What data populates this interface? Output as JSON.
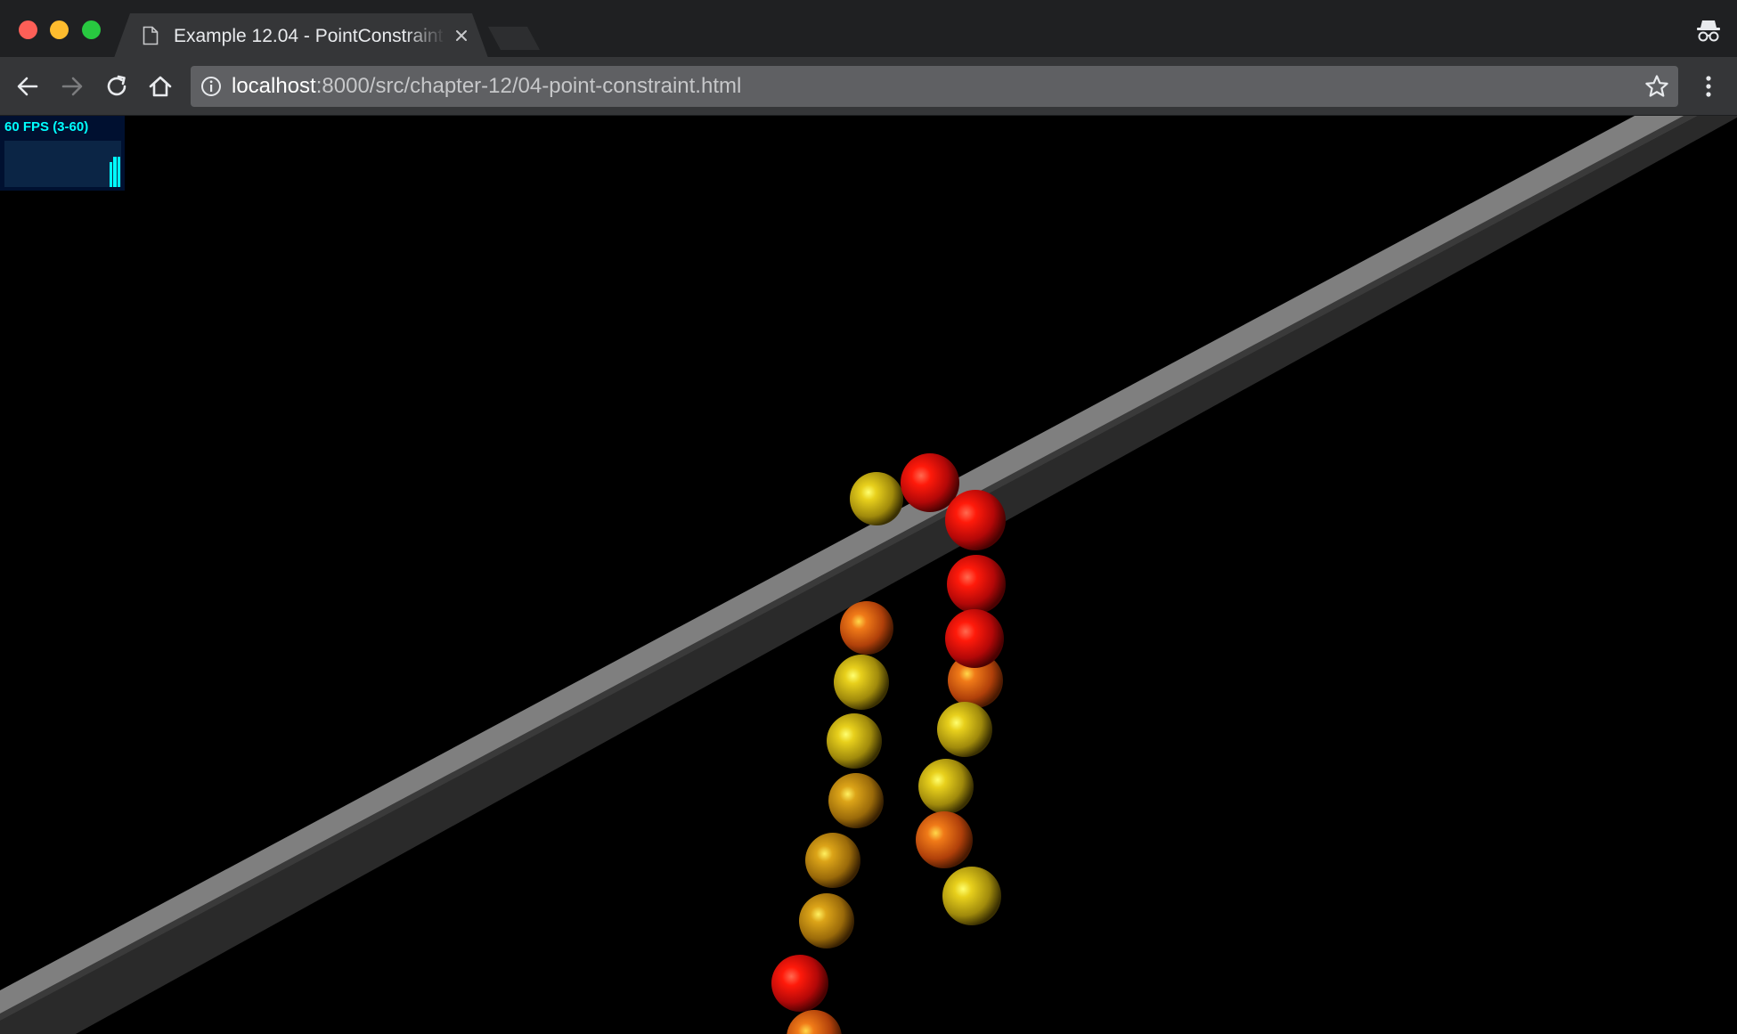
{
  "browser": {
    "tab": {
      "title": "Example 12.04 - PointConstraint"
    },
    "address_bar": {
      "url_host": "localhost",
      "url_rest": ":8000/src/chapter-12/04-point-constraint.html"
    },
    "icons": {
      "tab_page": "document-icon",
      "tab_close": "close-icon",
      "incognito": "incognito-icon",
      "back": "back-arrow-icon",
      "forward": "forward-arrow-icon",
      "reload": "reload-icon",
      "home": "home-icon",
      "site_info": "info-icon",
      "bookmark": "star-icon",
      "menu": "kebab-menu-icon"
    }
  },
  "stats_panel": {
    "label": "60 FPS (3-60)",
    "color": "#00ffff",
    "background": "#001030"
  },
  "scene": {
    "description_colors": {
      "background": "#000000",
      "bar_top": "#808080",
      "bar_side": "#2a2a2a",
      "sphere_red": "#e31010",
      "sphere_orange": "#d85a10",
      "sphere_yellow": "#d8c818"
    }
  }
}
